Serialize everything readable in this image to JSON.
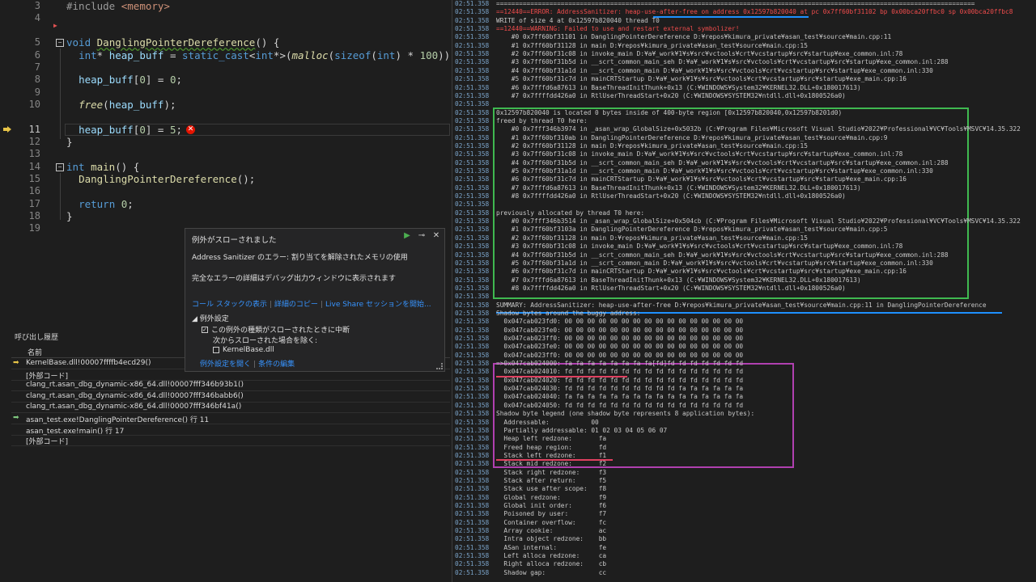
{
  "editor": {
    "lines": [
      {
        "n": "3",
        "html": "<span class='pp'>#include</span> <span class='inc'>&lt;memory&gt;</span>"
      },
      {
        "n": "4",
        "html": ""
      },
      {
        "n": "5",
        "html": "<span class='kw'>void</span> <span class='fn squig'>DanglingPointerDereference</span>() {"
      },
      {
        "n": "6",
        "html": "  <span class='kw'>int</span>* <span class='var'>heap_buff</span> = <span class='kw'>static_cast</span>&lt;<span class='kw'>int</span>*&gt;(<span class='fn it'>malloc</span>(<span class='kw'>sizeof</span>(<span class='kw'>int</span>) * <span class='num'>100</span>));"
      },
      {
        "n": "7",
        "html": ""
      },
      {
        "n": "8",
        "html": "  <span class='var'>heap_buff</span>[<span class='num'>0</span>] = <span class='num'>0</span>;"
      },
      {
        "n": "9",
        "html": ""
      },
      {
        "n": "10",
        "html": "  <span class='fn it'>free</span>(<span class='var'>heap_buff</span>);"
      },
      {
        "n": "11",
        "html": "  <span class='var'>heap_buff</span>[<span class='num'>0</span>] = <span class='num'>5</span>;"
      },
      {
        "n": "12",
        "html": "}"
      },
      {
        "n": "13",
        "html": ""
      },
      {
        "n": "14",
        "html": "<span class='kw'>int</span> <span class='fn'>main</span>() {"
      },
      {
        "n": "15",
        "html": "  <span class='fn'>DanglingPointerDereference</span>();"
      },
      {
        "n": "16",
        "html": ""
      },
      {
        "n": "17",
        "html": "  <span class='kw'>return</span> <span class='num'>0</span>;"
      },
      {
        "n": "18",
        "html": "}"
      },
      {
        "n": "19",
        "html": ""
      }
    ],
    "current_line": "11",
    "error_icon": "error-x-icon"
  },
  "exception_popup": {
    "title": "例外がスローされました",
    "message": "Address Sanitizer のエラー: 割り当てを解除されたメモリの使用",
    "detail": "完全なエラーの詳細はデバッグ出力ウィンドウに表示されます",
    "links": [
      "コール スタックの表示",
      "詳細のコピー",
      "Live Share セッションを開始..."
    ],
    "settings_header": "例外設定",
    "checkbox_break": "この例外の種類がスローされたときに中断",
    "except_label": "次からスローされた場合を除く:",
    "checkbox_module": "KernelBase.dll",
    "bottom_links": [
      "例外設定を開く",
      "条件の編集"
    ]
  },
  "call_stack": {
    "title": "呼び出し履歴",
    "column": "名前",
    "rows": [
      {
        "text": "KernelBase.dll!00007ffffb4ecd29()",
        "marker": "current"
      },
      {
        "text": "[外部コード]",
        "marker": ""
      },
      {
        "text": "clang_rt.asan_dbg_dynamic-x86_64.dll!00007fff346b93b1()",
        "marker": ""
      },
      {
        "text": "clang_rt.asan_dbg_dynamic-x86_64.dll!00007fff346babb6()",
        "marker": ""
      },
      {
        "text": "clang_rt.asan_dbg_dynamic-x86_64.dll!00007fff346bf41a()",
        "marker": ""
      },
      {
        "text": "asan_test.exe!DanglingPointerDereference() 行 11",
        "marker": "frame"
      },
      {
        "text": "asan_test.exe!main() 行 17",
        "marker": ""
      },
      {
        "text": "[外部コード]",
        "marker": ""
      }
    ]
  },
  "output": {
    "timestamp": "02:51.358",
    "lines": [
      {
        "t": "==============================================================================================================================",
        "red": false
      },
      {
        "t": "==12440==ERROR: AddressSanitizer: heap-use-after-free on address 0x12597b820040 at pc 0x7ff60bf31102 bp 0x00bca20ffbc0 sp 0x00bca20ffbc8",
        "red": true
      },
      {
        "t": "WRITE of size 4 at 0x12597b820040 thread T0",
        "red": false
      },
      {
        "t": "==12440==WARNING: Failed to use and restart external symbolizer!",
        "red": true
      },
      {
        "t": "    #0 0x7ff60bf31101 in DanglingPointerDereference D:¥repos¥kimura_private¥asan_test¥source¥main.cpp:11",
        "red": false
      },
      {
        "t": "    #1 0x7ff60bf31128 in main D:¥repos¥kimura_private¥asan_test¥source¥main.cpp:15",
        "red": false
      },
      {
        "t": "    #2 0x7ff60bf31c08 in invoke_main D:¥a¥_work¥1¥s¥src¥vctools¥crt¥vcstartup¥src¥startup¥exe_common.inl:78",
        "red": false
      },
      {
        "t": "    #3 0x7ff60bf31b5d in __scrt_common_main_seh D:¥a¥_work¥1¥s¥src¥vctools¥crt¥vcstartup¥src¥startup¥exe_common.inl:288",
        "red": false
      },
      {
        "t": "    #4 0x7ff60bf31a1d in __scrt_common_main D:¥a¥_work¥1¥s¥src¥vctools¥crt¥vcstartup¥src¥startup¥exe_common.inl:330",
        "red": false
      },
      {
        "t": "    #5 0x7ff60bf31c7d in mainCRTStartup D:¥a¥_work¥1¥s¥src¥vctools¥crt¥vcstartup¥src¥startup¥exe_main.cpp:16",
        "red": false
      },
      {
        "t": "    #6 0x7fffd6a87613 in BaseThreadInitThunk+0x13 (C:¥WINDOWS¥System32¥KERNEL32.DLL+0x180017613)",
        "red": false
      },
      {
        "t": "    #7 0x7ffffdd426a0 in RtlUserThreadStart+0x20 (C:¥WINDOWS¥SYSTEM32¥ntdll.dll+0x1800526a0)",
        "red": false
      },
      {
        "t": "",
        "red": false
      },
      {
        "t": "0x12597b820040 is located 0 bytes inside of 400-byte region [0x12597b820040,0x12597b8201d0)",
        "red": false
      },
      {
        "t": "freed by thread T0 here:",
        "red": false
      },
      {
        "t": "    #0 0x7fff346b3974 in _asan_wrap_GlobalSize+0x5032b (C:¥Program Files¥Microsoft Visual Studio¥2022¥Professional¥VC¥Tools¥MSVC¥14.35.322",
        "red": false
      },
      {
        "t": "    #1 0x7ff60bf310ab in DanglingPointerDereference D:¥repos¥kimura_private¥asan_test¥source¥main.cpp:9",
        "red": false
      },
      {
        "t": "    #2 0x7ff60bf31128 in main D:¥repos¥kimura_private¥asan_test¥source¥main.cpp:15",
        "red": false
      },
      {
        "t": "    #3 0x7ff60bf31c08 in invoke_main D:¥a¥_work¥1¥s¥src¥vctools¥crt¥vcstartup¥src¥startup¥exe_common.inl:78",
        "red": false
      },
      {
        "t": "    #4 0x7ff60bf31b5d in __scrt_common_main_seh D:¥a¥_work¥1¥s¥src¥vctools¥crt¥vcstartup¥src¥startup¥exe_common.inl:288",
        "red": false
      },
      {
        "t": "    #5 0x7ff60bf31a1d in __scrt_common_main D:¥a¥_work¥1¥s¥src¥vctools¥crt¥vcstartup¥src¥startup¥exe_common.inl:330",
        "red": false
      },
      {
        "t": "    #6 0x7ff60bf31c7d in mainCRTStartup D:¥a¥_work¥1¥s¥src¥vctools¥crt¥vcstartup¥src¥startup¥exe_main.cpp:16",
        "red": false
      },
      {
        "t": "    #7 0x7fffd6a87613 in BaseThreadInitThunk+0x13 (C:¥WINDOWS¥System32¥KERNEL32.DLL+0x180017613)",
        "red": false
      },
      {
        "t": "    #8 0x7ffffdd426a0 in RtlUserThreadStart+0x20 (C:¥WINDOWS¥SYSTEM32¥ntdll.dll+0x1800526a0)",
        "red": false
      },
      {
        "t": "",
        "red": false
      },
      {
        "t": "previously allocated by thread T0 here:",
        "red": false
      },
      {
        "t": "    #0 0x7fff346b3514 in _asan_wrap_GlobalSize+0x504cb (C:¥Program Files¥Microsoft Visual Studio¥2022¥Professional¥VC¥Tools¥MSVC¥14.35.322",
        "red": false
      },
      {
        "t": "    #1 0x7ff60bf3103a in DanglingPointerDereference D:¥repos¥kimura_private¥asan_test¥source¥main.cpp:5",
        "red": false
      },
      {
        "t": "    #2 0x7ff60bf31128 in main D:¥repos¥kimura_private¥asan_test¥source¥main.cpp:15",
        "red": false
      },
      {
        "t": "    #3 0x7ff60bf31c08 in invoke_main D:¥a¥_work¥1¥s¥src¥vctools¥crt¥vcstartup¥src¥startup¥exe_common.inl:78",
        "red": false
      },
      {
        "t": "    #4 0x7ff60bf31b5d in __scrt_common_main_seh D:¥a¥_work¥1¥s¥src¥vctools¥crt¥vcstartup¥src¥startup¥exe_common.inl:288",
        "red": false
      },
      {
        "t": "    #5 0x7ff60bf31a1d in __scrt_common_main D:¥a¥_work¥1¥s¥src¥vctools¥crt¥vcstartup¥src¥startup¥exe_common.inl:330",
        "red": false
      },
      {
        "t": "    #6 0x7ff60bf31c7d in mainCRTStartup D:¥a¥_work¥1¥s¥src¥vctools¥crt¥vcstartup¥src¥startup¥exe_main.cpp:16",
        "red": false
      },
      {
        "t": "    #7 0x7fffd6a87613 in BaseThreadInitThunk+0x13 (C:¥WINDOWS¥System32¥KERNEL32.DLL+0x180017613)",
        "red": false
      },
      {
        "t": "    #8 0x7ffffdd426a0 in RtlUserThreadStart+0x20 (C:¥WINDOWS¥SYSTEM32¥ntdll.dll+0x1800526a0)",
        "red": false
      },
      {
        "t": "",
        "red": false
      },
      {
        "t": "SUMMARY: AddressSanitizer: heap-use-after-free D:¥repos¥kimura_private¥asan_test¥source¥main.cpp:11 in DanglingPointerDereference",
        "red": false
      },
      {
        "t": "Shadow bytes around the buggy address:",
        "red": false
      },
      {
        "t": "  0x047cab023fd0: 00 00 00 00 00 00 00 00 00 00 00 00 00 00 00 00",
        "red": false
      },
      {
        "t": "  0x047cab023fe0: 00 00 00 00 00 00 00 00 00 00 00 00 00 00 00 00",
        "red": false
      },
      {
        "t": "  0x047cab023ff0: 00 00 00 00 00 00 00 00 00 00 00 00 00 00 00 00",
        "red": false
      },
      {
        "t": "  0x047cab023fe0: 00 00 00 00 00 00 00 00 00 00 00 00 00 00 00 00",
        "red": false
      },
      {
        "t": "  0x047cab023ff0: 00 00 00 00 00 00 00 00 00 00 00 00 00 00 00 00",
        "red": false
      },
      {
        "t": "=>0x047cab024000: fa fa fa fa fa fa fa fa[fd]fd fd fd fd fd fd fd",
        "red": false
      },
      {
        "t": "  0x047cab024010: fd fd fd fd fd fd fd fd fd fd fd fd fd fd fd fd",
        "red": false
      },
      {
        "t": "  0x047cab024020: fd fd fd fd fd fd fd fd fd fd fd fd fd fd fd fd",
        "red": false
      },
      {
        "t": "  0x047cab024030: fd fd fd fd fd fd fd fd fd fd fa fa fa fa fa fa",
        "red": false
      },
      {
        "t": "  0x047cab024040: fa fa fa fa fa fa fa fa fa fa fa fa fa fa fa fa",
        "red": false
      },
      {
        "t": "  0x047cab024050: fd fd fd fd fd fd fd fd fd fd fd fd fd fd fd fd",
        "red": false
      },
      {
        "t": "Shadow byte legend (one shadow byte represents 8 application bytes):",
        "red": false
      },
      {
        "t": "  Addressable:           00",
        "red": false
      },
      {
        "t": "  Partially addressable: 01 02 03 04 05 06 07",
        "red": false
      },
      {
        "t": "  Heap left redzone:       fa",
        "red": false
      },
      {
        "t": "  Freed heap region:       fd",
        "red": false
      },
      {
        "t": "  Stack left redzone:      f1",
        "red": false
      },
      {
        "t": "  Stack mid redzone:       f2",
        "red": false
      },
      {
        "t": "  Stack right redzone:     f3",
        "red": false
      },
      {
        "t": "  Stack after return:      f5",
        "red": false
      },
      {
        "t": "  Stack use after scope:   f8",
        "red": false
      },
      {
        "t": "  Global redzone:          f9",
        "red": false
      },
      {
        "t": "  Global init order:       f6",
        "red": false
      },
      {
        "t": "  Poisoned by user:        f7",
        "red": false
      },
      {
        "t": "  Container overflow:      fc",
        "red": false
      },
      {
        "t": "  Array cookie:            ac",
        "red": false
      },
      {
        "t": "  Intra object redzone:    bb",
        "red": false
      },
      {
        "t": "  ASan internal:           fe",
        "red": false
      },
      {
        "t": "  Left alloca redzone:     ca",
        "red": false
      },
      {
        "t": "  Right alloca redzone:    cb",
        "red": false
      },
      {
        "t": "  Shadow gap:              cc",
        "red": false
      }
    ]
  },
  "colors": {
    "green_box": "#3fb950",
    "magenta_box": "#b040b0",
    "blue_underline": "#1e90ff",
    "red_underline": "#e04060",
    "error_text": "#f14c4c"
  }
}
